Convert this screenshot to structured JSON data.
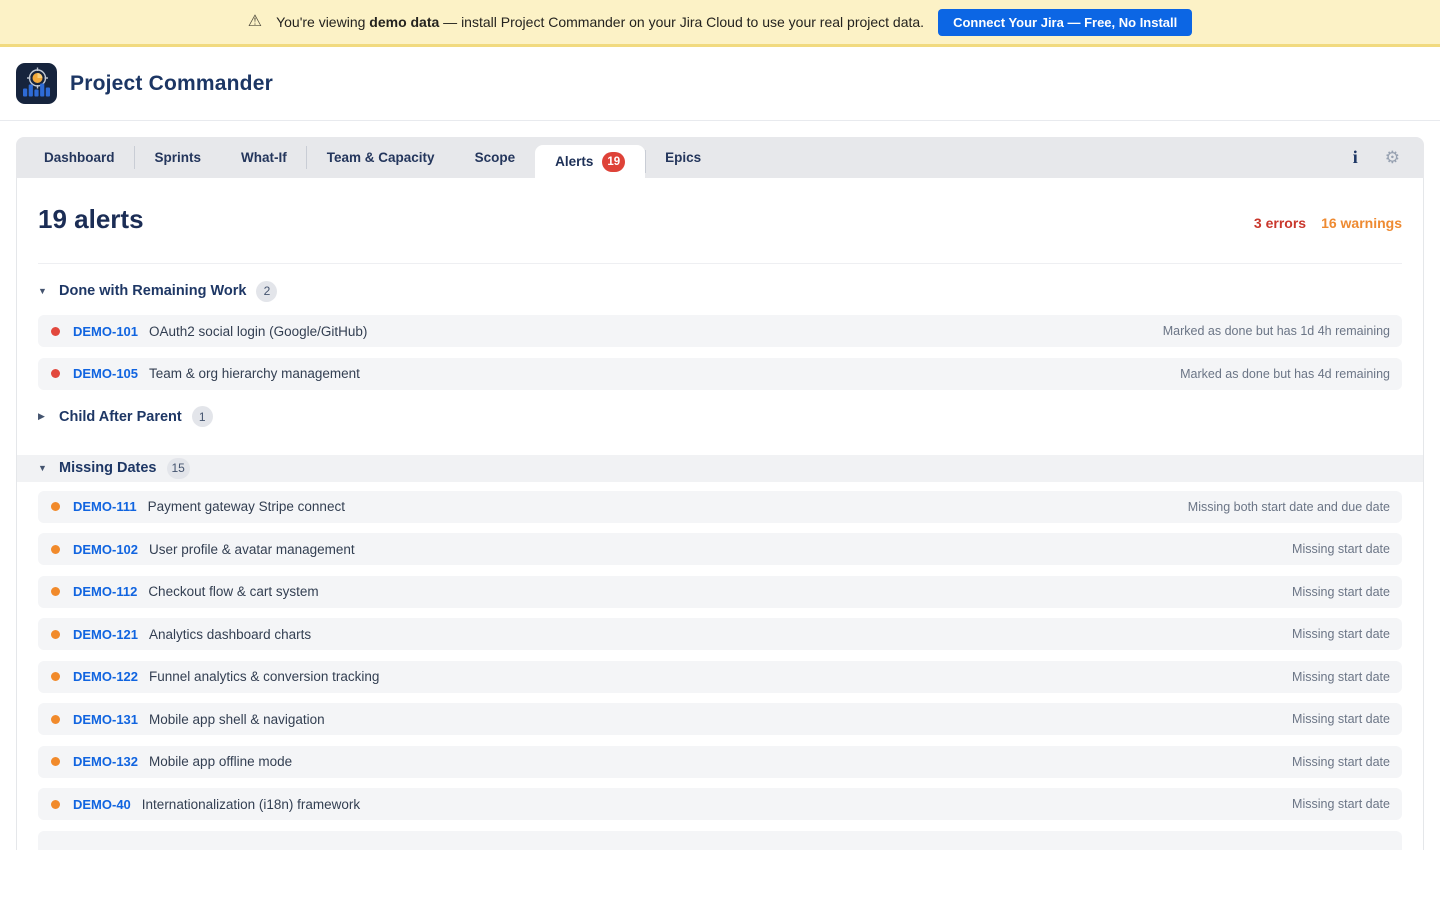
{
  "banner": {
    "text_prefix": "You're viewing ",
    "text_bold": "demo data",
    "text_suffix": " — install Project Commander on your Jira Cloud to use your real project data.",
    "button_label": "Connect Your Jira — Free, No Install"
  },
  "header": {
    "app_title": "Project Commander"
  },
  "icons": {
    "warning": "⚠",
    "info": "i",
    "gear": "⚙",
    "expanded": "▼",
    "collapsed": "▶"
  },
  "tabs": {
    "items": [
      {
        "label": "Dashboard",
        "active": false,
        "divider_after": true
      },
      {
        "label": "Sprints",
        "active": false
      },
      {
        "label": "What-If",
        "active": false,
        "divider_after": true
      },
      {
        "label": "Team & Capacity",
        "active": false
      },
      {
        "label": "Scope",
        "active": false
      },
      {
        "label": "Alerts",
        "badge": "19",
        "active": true,
        "divider_after": true
      },
      {
        "label": "Epics",
        "active": false
      }
    ]
  },
  "summary": {
    "title": "19 alerts",
    "errors": "3 errors",
    "warnings": "16 warnings"
  },
  "sections": [
    {
      "title": "Done with Remaining Work",
      "count": "2",
      "expanded": true,
      "banded": false,
      "items": [
        {
          "key": "DEMO-101",
          "summary": "OAuth2 social login (Google/GitHub)",
          "message": "Marked as done but has 1d 4h remaining",
          "severity": "error"
        },
        {
          "key": "DEMO-105",
          "summary": "Team & org hierarchy management",
          "message": "Marked as done but has 4d remaining",
          "severity": "error"
        }
      ]
    },
    {
      "title": "Child After Parent",
      "count": "1",
      "expanded": false,
      "banded": false,
      "items": []
    },
    {
      "title": "Missing Dates",
      "count": "15",
      "expanded": true,
      "banded": true,
      "items": [
        {
          "key": "DEMO-111",
          "summary": "Payment gateway Stripe connect",
          "message": "Missing both start date and due date",
          "severity": "warning"
        },
        {
          "key": "DEMO-102",
          "summary": "User profile & avatar management",
          "message": "Missing start date",
          "severity": "warning"
        },
        {
          "key": "DEMO-112",
          "summary": "Checkout flow & cart system",
          "message": "Missing start date",
          "severity": "warning"
        },
        {
          "key": "DEMO-121",
          "summary": "Analytics dashboard charts",
          "message": "Missing start date",
          "severity": "warning"
        },
        {
          "key": "DEMO-122",
          "summary": "Funnel analytics & conversion tracking",
          "message": "Missing start date",
          "severity": "warning"
        },
        {
          "key": "DEMO-131",
          "summary": "Mobile app shell & navigation",
          "message": "Missing start date",
          "severity": "warning"
        },
        {
          "key": "DEMO-132",
          "summary": "Mobile app offline mode",
          "message": "Missing start date",
          "severity": "warning"
        },
        {
          "key": "DEMO-40",
          "summary": "Internationalization (i18n) framework",
          "message": "Missing start date",
          "severity": "warning"
        },
        {
          "partial": true,
          "severity": "warning"
        }
      ]
    }
  ],
  "colors": {
    "banner_bg": "#FCF2C6",
    "banner_border": "#F1DA7F",
    "brand_blue": "#0C66E4",
    "navy": "#1C3664",
    "badge_red": "#DE4238",
    "error": "#E2483D",
    "warning": "#F18A2B",
    "row_bg": "#F4F5F7"
  }
}
